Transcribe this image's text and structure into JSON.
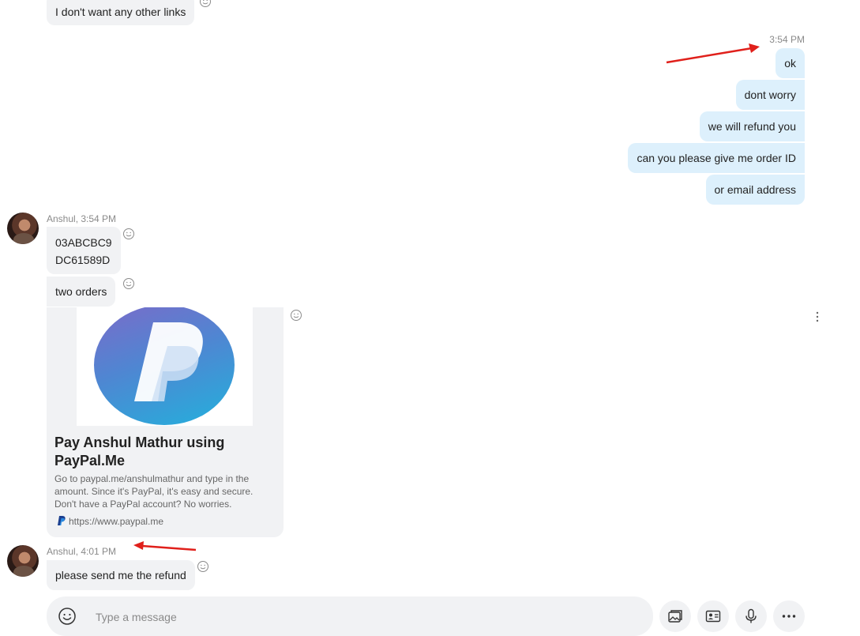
{
  "messages": {
    "top_incoming": {
      "text": "I don't want any other links"
    },
    "outgoing_group": {
      "time": "3:54 PM",
      "items": [
        "ok",
        "dont worry",
        "we will refund you",
        "can you please give me order ID",
        "or email address"
      ]
    },
    "anshul_group_1": {
      "header": "Anshul, 3:54 PM",
      "order_ids": [
        "03ABCBC9",
        "DC61589D"
      ],
      "second": "two orders",
      "link_card": {
        "title": "Pay Anshul Mathur using PayPal.Me",
        "description": "Go to paypal.me/anshulmathur and type in the amount. Since it's PayPal, it's easy and secure. Don't have a PayPal account? No worries.",
        "url": "https://www.paypal.me"
      }
    },
    "anshul_group_2": {
      "header": "Anshul, 4:01 PM",
      "text": "please send me the refund"
    }
  },
  "composer": {
    "placeholder": "Type a message"
  },
  "colors": {
    "incoming_bubble": "#f1f2f4",
    "outgoing_bubble": "#ddf0fc",
    "annotation_arrow": "#e0201b"
  },
  "icons": [
    "emoji-icon",
    "reaction-icon",
    "more-vertical-icon",
    "gallery-icon",
    "contact-card-icon",
    "microphone-icon",
    "more-horizontal-icon",
    "paypal-icon"
  ]
}
